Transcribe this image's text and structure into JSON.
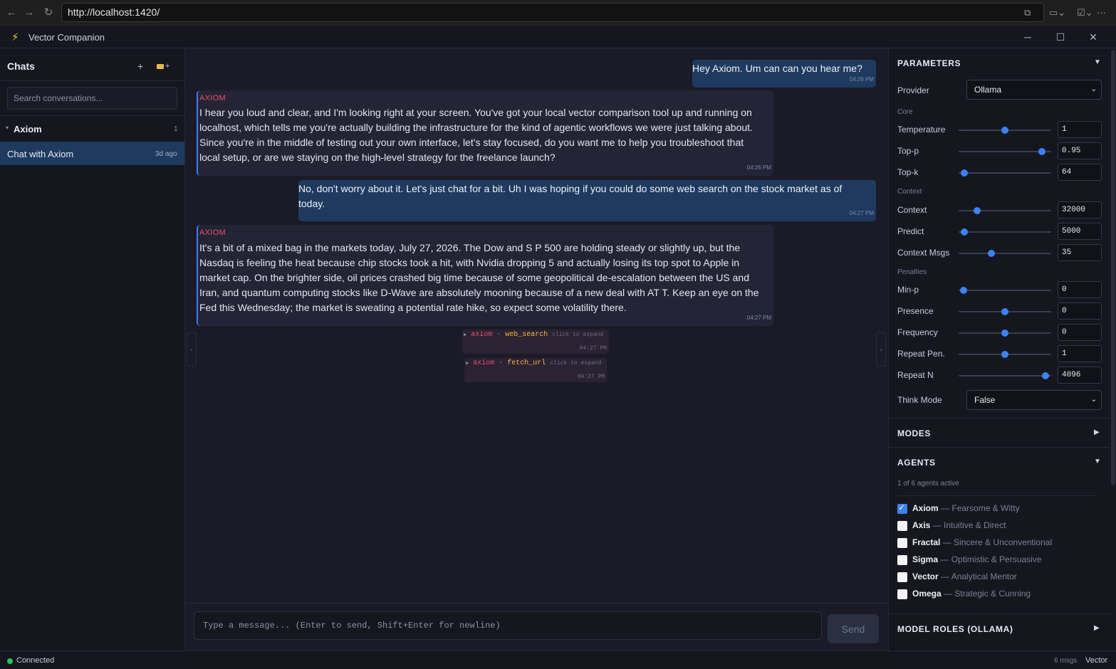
{
  "browser": {
    "url": "http://localhost:1420/",
    "back_icon": "←",
    "forward_icon": "→",
    "reload_icon": "↻",
    "tab_icon": "⧉",
    "cast_icon": "▭⌄",
    "ext_icon": "☑⌄",
    "menu_icon": "···"
  },
  "app": {
    "title": "Vector Companion",
    "bolt_icon": "⚡",
    "minimize": "─",
    "maximize": "☐",
    "close": "✕"
  },
  "sidebar": {
    "title": "Chats",
    "new_chat": "+",
    "new_folder": "+",
    "search_placeholder": "Search conversations...",
    "group": {
      "chevron": "▾",
      "name": "Axiom",
      "count": "1"
    },
    "chats": [
      {
        "title": "Chat with Axiom",
        "time": "3d ago"
      }
    ]
  },
  "messages": [
    {
      "role": "user",
      "text": "Hey Axiom. Um can can you hear me?",
      "time": "04:26 PM"
    },
    {
      "role": "ai",
      "label": "AXIOM",
      "text": "I hear you loud and clear, and I'm looking right at your screen. You've got your local vector comparison tool up and running on localhost, which tells me you're actually building the infrastructure for the kind of agentic workflows we were just talking about. Since you're in the middle of testing out your own interface, let's stay focused, do you want me to help you troubleshoot that local setup, or are we staying on the high-level strategy for the freelance launch?",
      "time": "04:26 PM"
    },
    {
      "role": "user",
      "text": "No, don't worry about it. Let's just chat for a bit. Uh I was hoping if you could do some web search on the stock market as of today.",
      "time": "04:27 PM"
    },
    {
      "role": "ai",
      "label": "AXIOM",
      "text": "It's a bit of a mixed bag in the markets today, July 27, 2026. The Dow and S   P 500 are holding steady or slightly up, but the Nasdaq is feeling the heat because chip stocks took a hit, with Nvidia dropping 5 and actually losing its top spot to Apple in market cap. On the brighter side, oil prices crashed big time because of some geopolitical de-escalation between the US and Iran, and quantum computing stocks like D-Wave are absolutely mooning because of a new deal with AT   T. Keep an eye on the Fed this Wednesday; the market is sweating a potential rate hike, so expect some volatility there.",
      "time": "04:27 PM"
    }
  ],
  "tool_calls": [
    {
      "arrow": "▶",
      "agent": "axiom",
      "sep": "·",
      "tool": "web_search",
      "hint": "click to expand",
      "time": "04:27 PM"
    },
    {
      "arrow": "▶",
      "agent": "axiom",
      "sep": "·",
      "tool": "fetch_url",
      "hint": "click to expand",
      "time": "04:27 PM"
    }
  ],
  "panel_toggles": {
    "left": "‹",
    "right": "›"
  },
  "composer": {
    "placeholder": "Type a message... (Enter to send, Shift+Enter for newline)",
    "send_label": "Send"
  },
  "parameters": {
    "title": "PARAMETERS",
    "toggle": "▼",
    "provider": {
      "label": "Provider",
      "value": "Ollama"
    },
    "groups": {
      "core": "Core",
      "context": "Context",
      "penalties": "Penalties"
    },
    "sliders": [
      {
        "label": "Temperature",
        "value": "1",
        "fraction": 0.5
      },
      {
        "label": "Top-p",
        "value": "0.95",
        "fraction": 0.9
      },
      {
        "label": "Top-k",
        "value": "64",
        "fraction": 0.06
      },
      {
        "label": "Context",
        "value": "32000",
        "fraction": 0.2
      },
      {
        "label": "Predict",
        "value": "5000",
        "fraction": 0.06
      },
      {
        "label": "Context Msgs",
        "value": "35",
        "fraction": 0.35
      },
      {
        "label": "Min-p",
        "value": "0",
        "fraction": 0.05
      },
      {
        "label": "Presence",
        "value": "0",
        "fraction": 0.5
      },
      {
        "label": "Frequency",
        "value": "0",
        "fraction": 0.5
      },
      {
        "label": "Repeat Pen.",
        "value": "1",
        "fraction": 0.5
      },
      {
        "label": "Repeat N",
        "value": "4096",
        "fraction": 0.94
      }
    ],
    "think_mode": {
      "label": "Think Mode",
      "value": "False"
    }
  },
  "modes": {
    "title": "MODES",
    "toggle": "▶"
  },
  "agents": {
    "title": "AGENTS",
    "toggle": "▼",
    "summary": "1 of 6 agents active",
    "list": [
      {
        "name": "Axiom",
        "desc": "— Fearsome & Witty",
        "checked": true
      },
      {
        "name": "Axis",
        "desc": "— Intuitive & Direct",
        "checked": false
      },
      {
        "name": "Fractal",
        "desc": "— Sincere & Unconventional",
        "checked": false
      },
      {
        "name": "Sigma",
        "desc": "— Optimistic & Persuasive",
        "checked": false
      },
      {
        "name": "Vector",
        "desc": "— Analytical Mentor",
        "checked": false
      },
      {
        "name": "Omega",
        "desc": "— Strategic & Cunning",
        "checked": false
      }
    ]
  },
  "model_roles": {
    "title": "MODEL ROLES (OLLAMA)",
    "toggle": "▶"
  },
  "status": {
    "connection": "Connected",
    "msg_count": "6 msgs",
    "agent": "Vector",
    "connection_color": "#22c55e"
  }
}
